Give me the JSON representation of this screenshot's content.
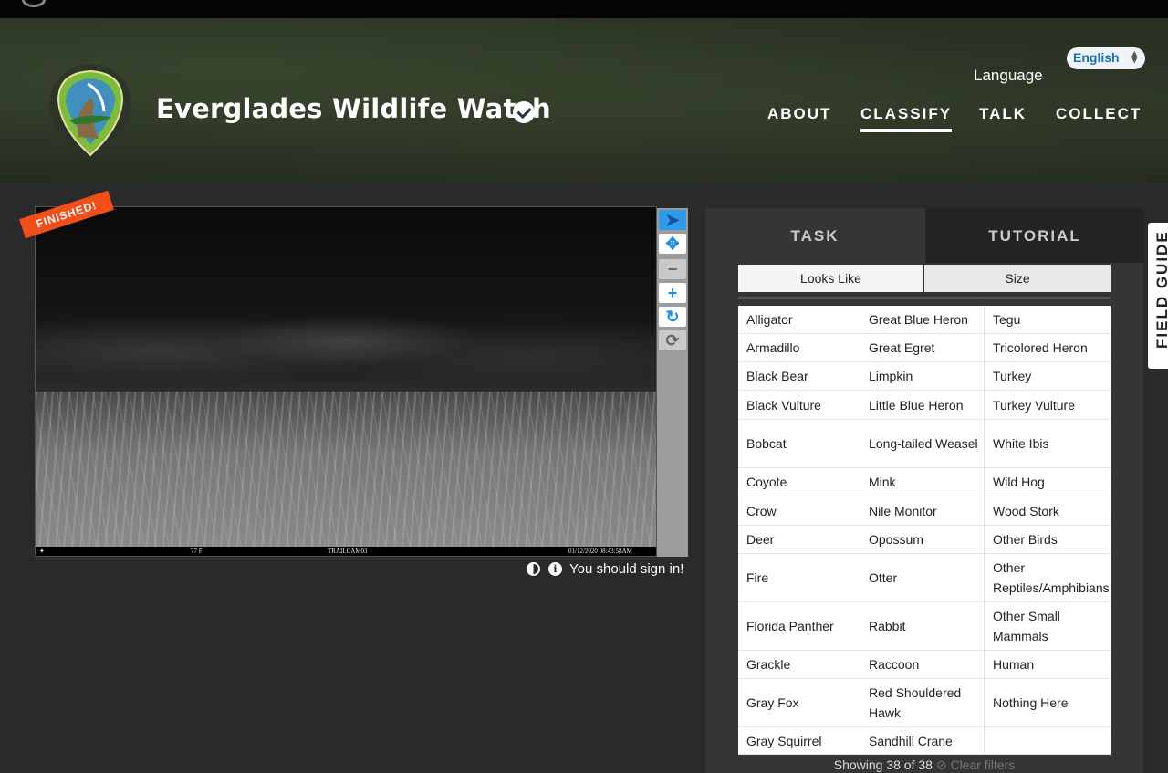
{
  "header": {
    "project_title": "Everglades Wildlife Watch",
    "language_label": "Language",
    "language_value": "English",
    "nav": [
      {
        "label": "ABOUT"
      },
      {
        "label": "CLASSIFY"
      },
      {
        "label": "TALK"
      },
      {
        "label": "COLLECT"
      }
    ]
  },
  "viewer": {
    "finished_badge": "FINISHED!",
    "info_strip": {
      "temperature": "77 F",
      "camera": "TRAILCAM03",
      "timestamp": "01/12/2020  08:43:58AM"
    },
    "sign_in_text": "You should sign in!"
  },
  "panel": {
    "tabs": [
      "TASK",
      "TUTORIAL"
    ],
    "filters": [
      "Looks Like",
      "Size"
    ],
    "choices": [
      [
        "Alligator",
        "Great Blue Heron",
        "Tegu"
      ],
      [
        "Armadillo",
        "Great Egret",
        "Tricolored Heron"
      ],
      [
        "Black Bear",
        "Limpkin",
        "Turkey"
      ],
      [
        "Black Vulture",
        "Little Blue Heron",
        "Turkey Vulture"
      ],
      [
        "Bobcat",
        "Long-tailed Weasel",
        "White Ibis"
      ],
      [
        "Coyote",
        "Mink",
        "Wild Hog"
      ],
      [
        "Crow",
        "Nile Monitor",
        "Wood Stork"
      ],
      [
        "Deer",
        "Opossum",
        "Other Birds"
      ],
      [
        "Fire",
        "Otter",
        "Other Reptiles/Amphibians"
      ],
      [
        "Florida Panther",
        "Rabbit",
        "Other Small Mammals"
      ],
      [
        "Grackle",
        "Raccoon",
        "Human"
      ],
      [
        "Gray Fox",
        "Red Shouldered Hawk",
        "Nothing Here"
      ],
      [
        "Gray Squirrel",
        "Sandhill Crane",
        ""
      ]
    ],
    "showing_text": "Showing 38 of 38",
    "clear_filters": "Clear filters"
  },
  "field_guide_label": "FIELD GUIDE",
  "colors": {
    "accent_blue": "#1a8ee8",
    "finished_orange": "#f04e1b",
    "panel_bg": "#353535"
  }
}
